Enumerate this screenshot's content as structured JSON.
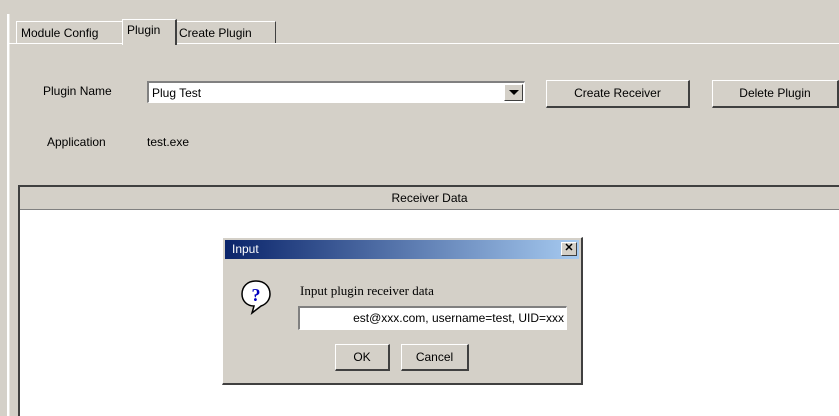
{
  "tabs": [
    {
      "label": "Module Config"
    },
    {
      "label": "Plugin"
    },
    {
      "label": "Create Plugin"
    }
  ],
  "plugin_form": {
    "name_label": "Plugin Name",
    "name_value": "Plug Test",
    "create_receiver_label": "Create Receiver",
    "delete_plugin_label": "Delete Plugin",
    "application_label": "Application",
    "application_value": "test.exe"
  },
  "receiver_panel": {
    "header": "Receiver Data"
  },
  "dialog": {
    "title": "Input",
    "close_glyph": "✕",
    "prompt": "Input plugin receiver data",
    "input_value": "est@xxx.com, username=test, UID=xxx",
    "ok_label": "OK",
    "cancel_label": "Cancel"
  }
}
